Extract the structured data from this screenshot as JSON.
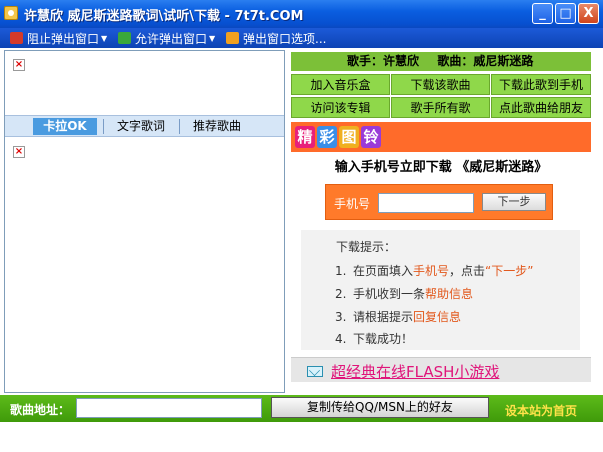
{
  "window": {
    "title": "许慧欣 威尼斯迷路歌词\\试听\\下载 - 7t7t.COM",
    "minimize": "_",
    "maximize": "□",
    "close": "X"
  },
  "toolbar": {
    "block_popup": "阻止弹出窗口",
    "allow_popup": "允许弹出窗口",
    "popup_options": "弹出窗口选项..."
  },
  "left_tabs": {
    "karaoke": "卡拉OK",
    "text_lyrics": "文字歌词",
    "recommend": "推荐歌曲"
  },
  "song_info": {
    "singer_label": "歌手：",
    "singer": "许慧欣",
    "song_label": "歌曲：",
    "song": "威尼斯迷路"
  },
  "actions": [
    "加入音乐盒",
    "下载该歌曲",
    "下载此歌到手机",
    "访问该专辑",
    "歌手所有歌",
    "点此歌曲给朋友"
  ],
  "promo_chars": [
    "精",
    "彩",
    "图",
    "铃"
  ],
  "download": {
    "heading": "输入手机号立即下载 《威尼斯迷路》",
    "phone_label": "手机号",
    "phone_value": "",
    "next_button": "下一步"
  },
  "tips": {
    "title": "下载提示：",
    "step1_num": "1.",
    "step1_a": "在页面填入",
    "step1_b": "手机号",
    "step1_c": "，点击",
    "step1_d": "“下一步”",
    "step2_num": "2.",
    "step2_a": "手机收到一条",
    "step2_b": "帮助信息",
    "step3_num": "3.",
    "step3_a": "请根据提示",
    "step3_b": "回复信息",
    "step4_num": "4.",
    "step4_a": "下载成功！"
  },
  "game_link": "超经典在线FLASH小游戏",
  "bottom": {
    "address_label": "歌曲地址：",
    "address_value": "",
    "copy_button": "复制传给QQ/MSN上的好友",
    "home_link": "设本站为首页"
  },
  "colors": {
    "title_blue": "#0a5ee0",
    "green": "#8fd84a",
    "orange": "#ff6b2a",
    "link_pink": "#e0147a"
  }
}
